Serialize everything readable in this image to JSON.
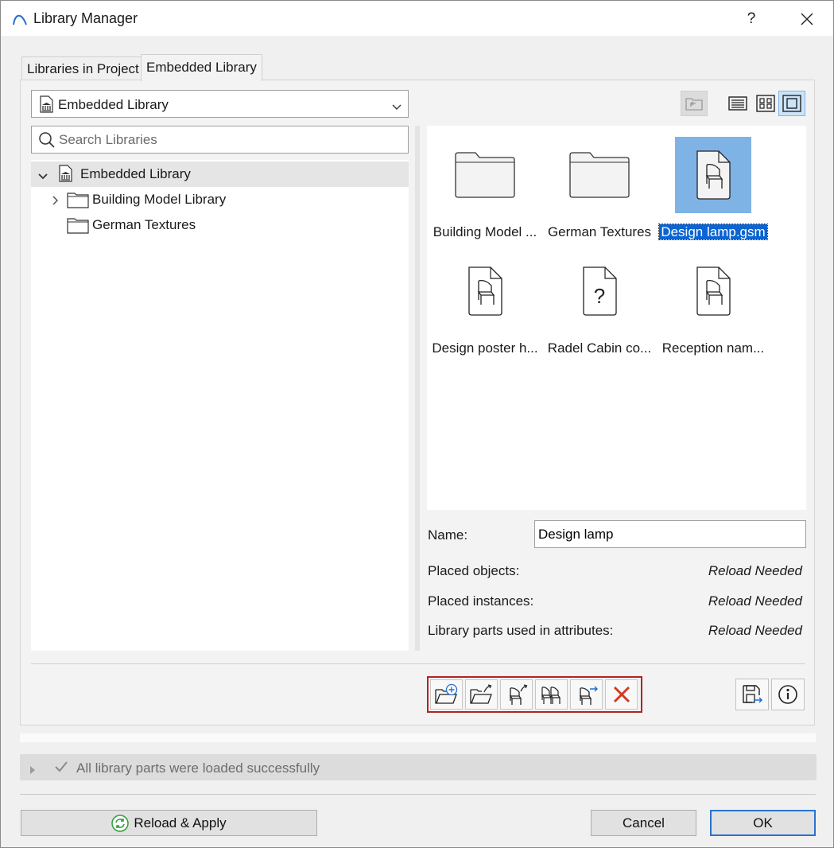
{
  "window": {
    "title": "Library Manager",
    "help_label": "?",
    "icons": {
      "app": "archicad-arc-icon",
      "close": "close-icon"
    }
  },
  "tabs": [
    {
      "label": "Libraries in Project",
      "active": false
    },
    {
      "label": "Embedded Library",
      "active": true
    }
  ],
  "library_selector": {
    "value": "Embedded Library",
    "icon": "library-building-icon"
  },
  "view_buttons": [
    {
      "name": "go-up-folder-icon",
      "enabled": false
    },
    {
      "name": "list-view-icon",
      "active": false
    },
    {
      "name": "small-icons-view-icon",
      "active": false
    },
    {
      "name": "large-icons-view-icon",
      "active": true
    }
  ],
  "search": {
    "placeholder": "Search Libraries",
    "value": ""
  },
  "tree": [
    {
      "label": "Embedded Library",
      "level": 0,
      "expanded": true,
      "selected": true,
      "icon": "library-building-icon"
    },
    {
      "label": "Building Model Library",
      "level": 1,
      "expandable": true,
      "icon": "folder-icon"
    },
    {
      "label": "German Textures",
      "level": 1,
      "expandable": false,
      "icon": "folder-icon"
    }
  ],
  "grid_items": [
    {
      "label": "Building Model ...",
      "icon": "folder-icon",
      "selected": false
    },
    {
      "label": "German Textures",
      "icon": "folder-icon",
      "selected": false
    },
    {
      "label": "Design lamp.gsm",
      "icon": "chair-object-file-icon",
      "selected": true
    },
    {
      "label": "Design poster h...",
      "icon": "chair-object-file-icon",
      "selected": false
    },
    {
      "label": "Radel Cabin co...",
      "icon": "unknown-file-icon",
      "selected": false
    },
    {
      "label": "Reception nam...",
      "icon": "chair-object-file-icon",
      "selected": false
    }
  ],
  "details": {
    "name_label": "Name:",
    "name_value": "Design lamp",
    "rows": [
      {
        "label": "Placed objects:",
        "value": "Reload Needed"
      },
      {
        "label": "Placed instances:",
        "value": "Reload Needed"
      },
      {
        "label": "Library parts used in attributes:",
        "value": "Reload Needed"
      }
    ]
  },
  "toolbar": {
    "tools": [
      "new-folder-icon",
      "import-folder-icon",
      "import-object-icon",
      "duplicate-object-icon",
      "move-object-icon",
      "delete-icon"
    ],
    "right_tools": [
      "save-export-icon",
      "info-icon"
    ],
    "accent_color": "#b22222"
  },
  "status": {
    "message": "All library parts were loaded successfully"
  },
  "buttons": {
    "reload": "Reload & Apply",
    "cancel": "Cancel",
    "ok": "OK"
  },
  "colors": {
    "selection": "#0a64d2",
    "icon_selection_bg": "#7fb3e6",
    "ok_border": "#2a72d0",
    "delete_red": "#d23a23",
    "reload_green": "#2e9e3b"
  }
}
